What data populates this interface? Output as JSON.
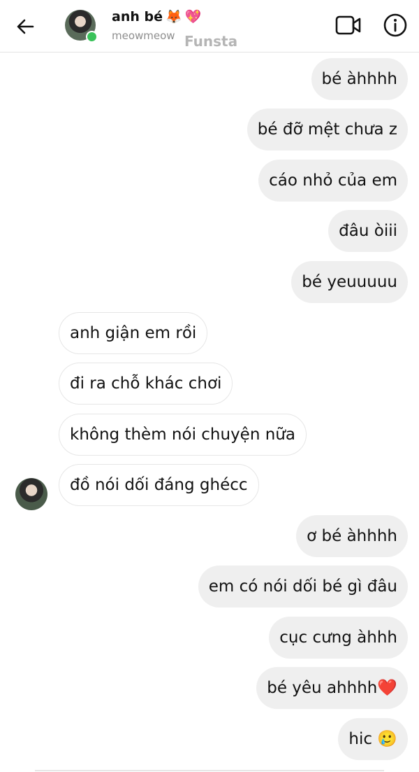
{
  "header": {
    "name": "anh bé",
    "name_emojis": [
      "🦊",
      "💖"
    ],
    "username": "meowmeow",
    "watermark": "Funsta"
  },
  "icons": {
    "back": "arrow-left-icon",
    "video": "video-camera-icon",
    "info": "info-icon",
    "online": "online-status-dot"
  },
  "colors": {
    "outgoing_bubble": "#efefef",
    "incoming_bubble": "#ffffff",
    "online": "#3ac25a",
    "heart": "#e0245e"
  },
  "messages": [
    {
      "side": "right",
      "text": "bé àhhhh"
    },
    {
      "side": "right",
      "text": "bé đỡ mệt chưa z"
    },
    {
      "side": "right",
      "text": "cáo nhỏ của em"
    },
    {
      "side": "right",
      "text": "đâu òiii"
    },
    {
      "side": "right",
      "text": "bé yeuuuuu"
    },
    {
      "side": "left",
      "text": "anh giận em rồi"
    },
    {
      "side": "left",
      "text": "đi ra chỗ khác chơi"
    },
    {
      "side": "left",
      "text": "không thèm nói chuyện nữa"
    },
    {
      "side": "left",
      "text": "đồ nói dối đáng ghécc"
    },
    {
      "side": "right",
      "text": "ơ bé àhhhh"
    },
    {
      "side": "right",
      "text": "em có nói dối bé gì đâu"
    },
    {
      "side": "right",
      "text": "cục cưng àhhh"
    },
    {
      "side": "right",
      "text": "bé yêu ahhhh",
      "emoji": "❤️"
    },
    {
      "side": "right",
      "text": "hic",
      "emoji": "🥲"
    }
  ]
}
